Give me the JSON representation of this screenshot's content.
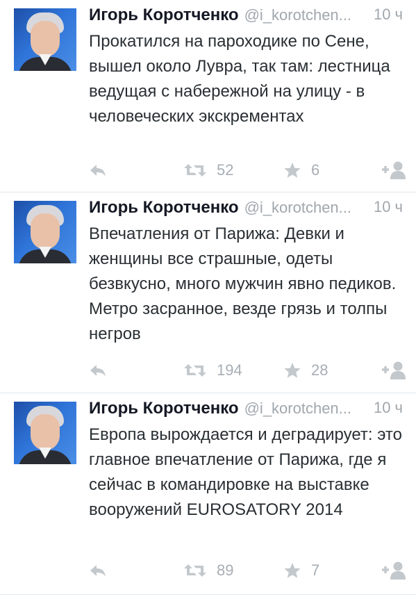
{
  "tweets": [
    {
      "name": "Игорь Коротченко",
      "handle": "@i_korotchen...",
      "time": "10 ч",
      "text": "Прокатился на пароходике по Сене, вышел около Лувра, так там: лестница ведущая с набережной на улицу -  в человеческих экскрементах",
      "retweets": "52",
      "favorites": "6"
    },
    {
      "name": "Игорь Коротченко",
      "handle": "@i_korotchen...",
      "time": "10 ч",
      "text": "Впечатления от Парижа: Девки и женщины все страшные, одеты безвкусно, много мужчин явно педиков. Метро засранное, везде грязь и толпы негров",
      "retweets": "194",
      "favorites": "28"
    },
    {
      "name": "Игорь Коротченко",
      "handle": "@i_korotchen...",
      "time": "10 ч",
      "text": "Европа вырождается и деградирует: это главное впечатление от Парижа, где я сейчас в командировке на выставке вооружений EUROSATORY 2014",
      "retweets": "89",
      "favorites": "7"
    }
  ],
  "icons": {
    "reply": "reply-icon",
    "retweet": "retweet-icon",
    "favorite": "star-icon",
    "follow": "follow-icon"
  },
  "colors": {
    "name": "#141823",
    "text": "#292f33",
    "muted": "#a0a7ad",
    "icon": "#c3c8cc",
    "divider": "#e1e8ed"
  }
}
